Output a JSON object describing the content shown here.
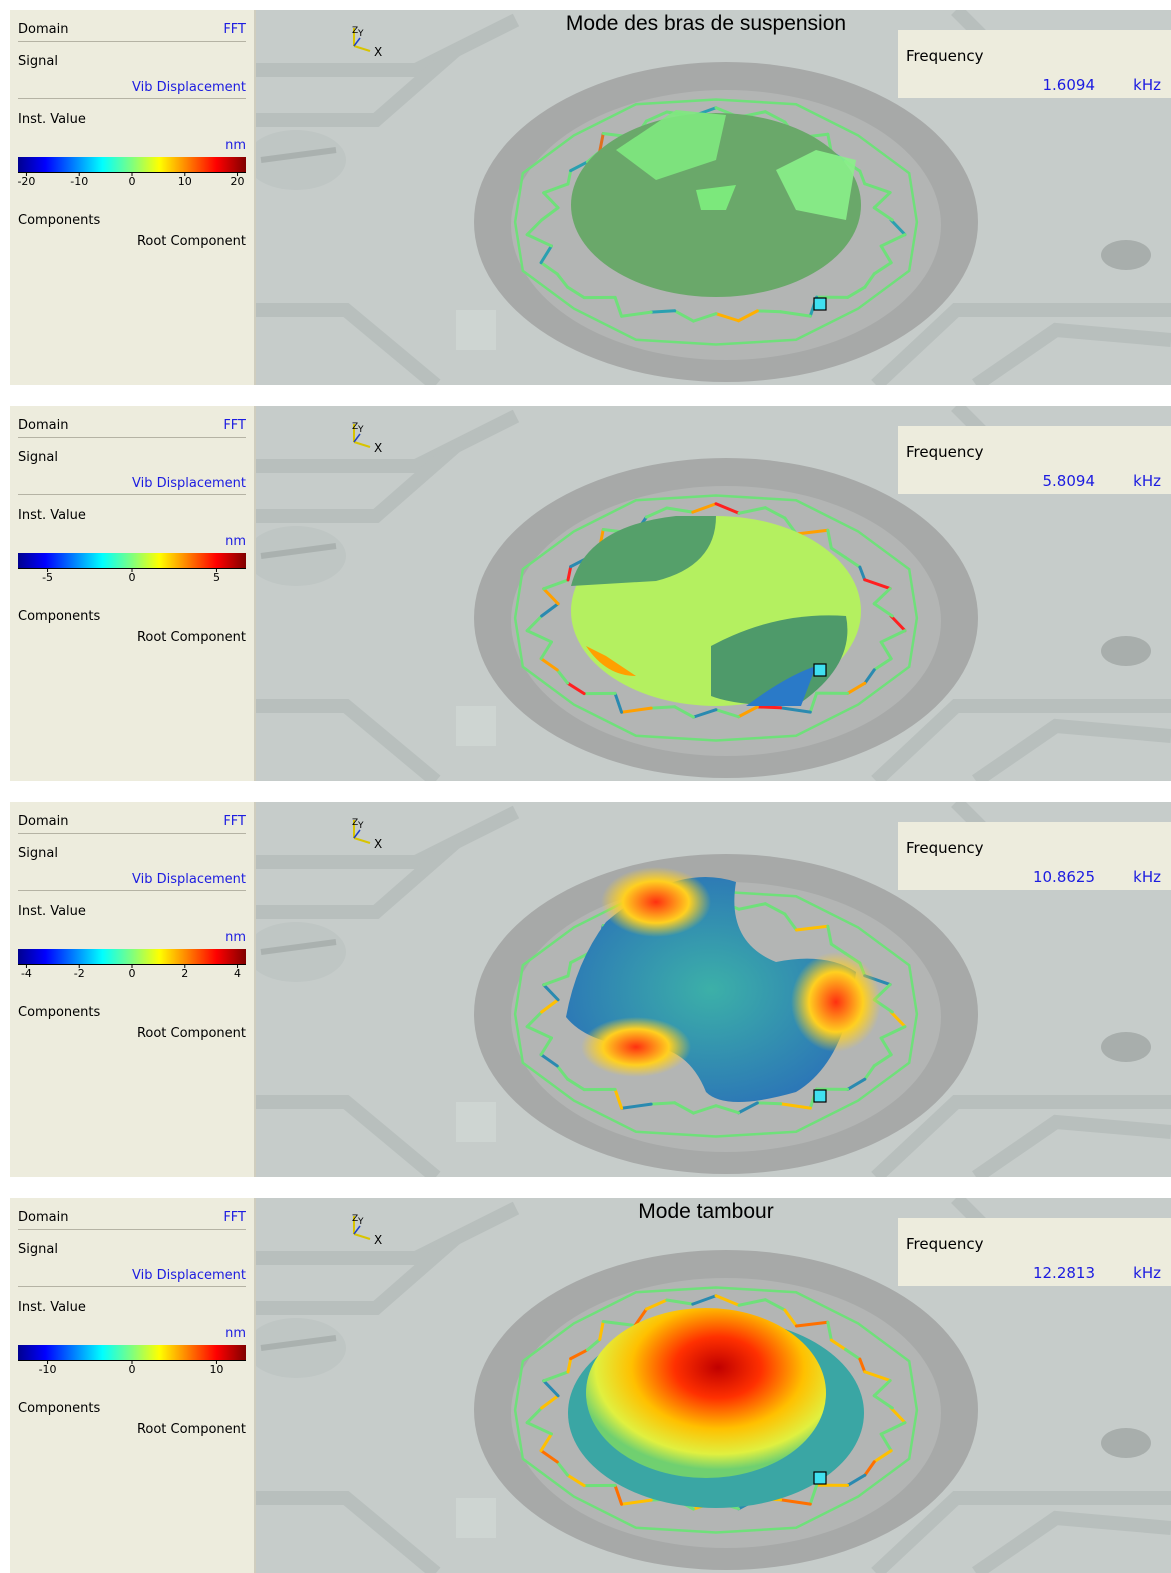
{
  "panels": [
    {
      "title": "Mode des bras de suspension",
      "domain_label": "Domain",
      "domain_value": "FFT",
      "signal_label": "Signal",
      "signal_value": "Vib Displacement",
      "inst_label": "Inst. Value",
      "unit": "nm",
      "ticks": [
        "-20",
        "-10",
        "0",
        "10",
        "20"
      ],
      "components_label": "Components",
      "components_value": "Root Component",
      "axis_z": "Z",
      "axis_y": "Y",
      "axis_x": "X",
      "freq_label": "Frequency",
      "freq_value": "1.6094",
      "freq_unit": "kHz",
      "mode": "arms"
    },
    {
      "title": "",
      "domain_label": "Domain",
      "domain_value": "FFT",
      "signal_label": "Signal",
      "signal_value": "Vib Displacement",
      "inst_label": "Inst. Value",
      "unit": "nm",
      "ticks": [
        "-5",
        "0",
        "5"
      ],
      "components_label": "Components",
      "components_value": "Root Component",
      "axis_z": "Z",
      "axis_y": "Y",
      "axis_x": "X",
      "freq_label": "Frequency",
      "freq_value": "5.8094",
      "freq_unit": "kHz",
      "mode": "rocking"
    },
    {
      "title": "",
      "domain_label": "Domain",
      "domain_value": "FFT",
      "signal_label": "Signal",
      "signal_value": "Vib Displacement",
      "inst_label": "Inst. Value",
      "unit": "nm",
      "ticks": [
        "-4",
        "-2",
        "0",
        "2",
        "4"
      ],
      "components_label": "Components",
      "components_value": "Root Component",
      "axis_z": "Z",
      "axis_y": "Y",
      "axis_x": "X",
      "freq_label": "Frequency",
      "freq_value": "10.8625",
      "freq_unit": "kHz",
      "mode": "saddle"
    },
    {
      "title": "Mode tambour",
      "domain_label": "Domain",
      "domain_value": "FFT",
      "signal_label": "Signal",
      "signal_value": "Vib Displacement",
      "inst_label": "Inst. Value",
      "unit": "nm",
      "ticks": [
        "-10",
        "0",
        "10"
      ],
      "components_label": "Components",
      "components_value": "Root Component",
      "axis_z": "Z",
      "axis_y": "Y",
      "axis_x": "X",
      "freq_label": "Frequency",
      "freq_value": "12.2813",
      "freq_unit": "kHz",
      "mode": "drum"
    }
  ],
  "colors": {
    "sidebar_bg": "#edecdd",
    "value_blue": "#1c1ce0",
    "mesh_green": "#6fe07a",
    "background_gray": "#c9cfcd"
  }
}
